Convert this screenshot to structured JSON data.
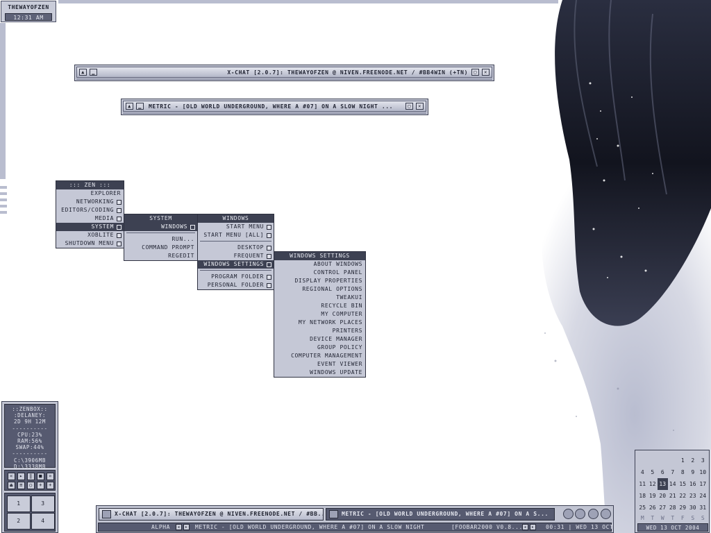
{
  "clock": {
    "user": "THEWAYOFZEN",
    "time": "12:31 AM"
  },
  "windows": {
    "xchat": {
      "title": "X-CHAT [2.0.7]: THEWAYOFZEN @ NIVEN.FREENODE.NET / #BB4WIN (+TN)"
    },
    "metric": {
      "title": "METRIC - [OLD WORLD UNDERGROUND, WHERE A #07] ON A SLOW NIGHT ..."
    }
  },
  "menus": {
    "zen": {
      "title": "::: ZEN :::",
      "items": [
        "EXPLORER",
        "NETWORKING",
        "EDITORS/CODING",
        "MEDIA",
        "SYSTEM",
        "XOBLITE",
        "SHUTDOWN MENU"
      ]
    },
    "system": {
      "title": "SYSTEM",
      "items": [
        "WINDOWS",
        "RUN...",
        "COMMAND PROMPT",
        "REGEDIT"
      ]
    },
    "windows": {
      "title": "WINDOWS",
      "items": [
        "START MENU",
        "START MENU [ALL]",
        "DESKTOP",
        "FREQUENT",
        "WINDOWS SETTINGS",
        "PROGRAM FOLDER",
        "PERSONAL FOLDER"
      ]
    },
    "settings": {
      "title": "WINDOWS SETTINGS",
      "items": [
        "ABOUT WINDOWS",
        "CONTROL PANEL",
        "DISPLAY PROPERTIES",
        "REGIONAL OPTIONS",
        "TWEAKUI",
        "RECYCLE BIN",
        "MY COMPUTER",
        "MY NETWORK PLACES",
        "PRINTERS",
        "DEVICE MANAGER",
        "GROUP POLICY",
        "COMPUTER MANAGEMENT",
        "EVENT VIEWER",
        "WINDOWS UPDATE"
      ]
    }
  },
  "zenbox": {
    "lines": [
      "::ZENBOX::",
      ":DELANEY:",
      "2D 9H 12M",
      "----------",
      "CPU:23%",
      "RAM:56%",
      "SWAP:44%",
      "----------",
      "C:\\3906MB",
      "D:\\3338MB"
    ],
    "desktops": [
      "1",
      "3",
      "2",
      "4"
    ]
  },
  "calendar": {
    "weeks": [
      [
        "",
        "",
        "",
        "",
        "1",
        "2",
        "3"
      ],
      [
        "4",
        "5",
        "6",
        "7",
        "8",
        "9",
        "10"
      ],
      [
        "11",
        "12",
        "13",
        "14",
        "15",
        "16",
        "17"
      ],
      [
        "18",
        "19",
        "20",
        "21",
        "22",
        "23",
        "24"
      ],
      [
        "25",
        "26",
        "27",
        "28",
        "29",
        "30",
        "31"
      ]
    ],
    "today": "13",
    "weekdays": [
      "M",
      "T",
      "W",
      "T",
      "F",
      "S",
      "S"
    ],
    "date": "WED 13 OCT 2004"
  },
  "taskbar": {
    "tasks": [
      "X-CHAT [2.0.7]: THEWAYOFZEN @ NIVEN.FREENODE.NET / #BB...",
      "METRIC - [OLD WORLD UNDERGROUND, WHERE A #07] ON A S..."
    ],
    "status": {
      "workspace": "ALPHA",
      "nowplaying": "METRIC - [OLD WORLD UNDERGROUND, WHERE A #07] ON A SLOW NIGHT",
      "player": "[FOOBAR2000 V0.8...",
      "clock": "00:31 | WED 13 OCT"
    }
  }
}
